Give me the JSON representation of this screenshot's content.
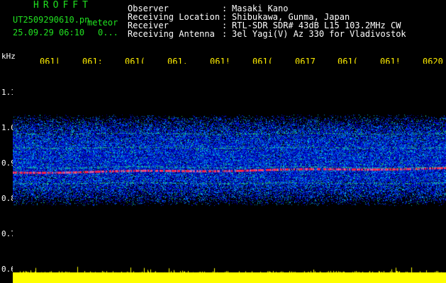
{
  "header": {
    "title": "HROFFT",
    "filename": "UT2509290610.pn",
    "meteor_label": "meteor",
    "datetime": "25.09.29 06:10",
    "count": "0..."
  },
  "meta": [
    {
      "label": "Observer",
      "value": "Masaki Kano"
    },
    {
      "label": "Receiving Location",
      "value": "Shibukawa, Gunma, Japan"
    },
    {
      "label": "Receiver",
      "value": "RTL-SDR SDR# 43dB L15 103.2MHz CW"
    },
    {
      "label": "Receiving Antenna",
      "value": "3el Yagi(V) Az 330 for Vladivostok"
    }
  ],
  "colors": {
    "background": "#000000",
    "title": "#20e020",
    "labels": "#ffffff",
    "time_labels": "#ffee00",
    "signal_bar": "#ffff00"
  },
  "chart_data": {
    "type": "heatmap",
    "ylabel": "kHz",
    "yticks": [
      "1.1",
      "1.0",
      "0.9",
      "0.8",
      "0.7",
      "0.6"
    ],
    "ylim": [
      0.6,
      1.15
    ],
    "xticks": [
      "0611",
      "0612",
      "0613",
      "0614",
      "0615",
      "0616",
      "0617",
      "0618",
      "0619",
      "0620"
    ],
    "xticks_shown": [
      "061|",
      "061:",
      "061(",
      "061.",
      "061!",
      "061(",
      "0617",
      "061(",
      "061!",
      "0620"
    ],
    "noise_band_khz": [
      0.78,
      1.04
    ],
    "lines_khz": [
      {
        "freq": 0.875,
        "color": "red",
        "strength": 1.0
      },
      {
        "freq": 0.89,
        "color": "green",
        "strength": 0.6
      },
      {
        "freq": 0.945,
        "color": "green",
        "strength": 0.5
      },
      {
        "freq": 0.985,
        "color": "green",
        "strength": 0.4
      },
      {
        "freq": 0.845,
        "color": "green",
        "strength": 0.5
      }
    ],
    "signal_bar_baseline_khz": 0.6
  }
}
